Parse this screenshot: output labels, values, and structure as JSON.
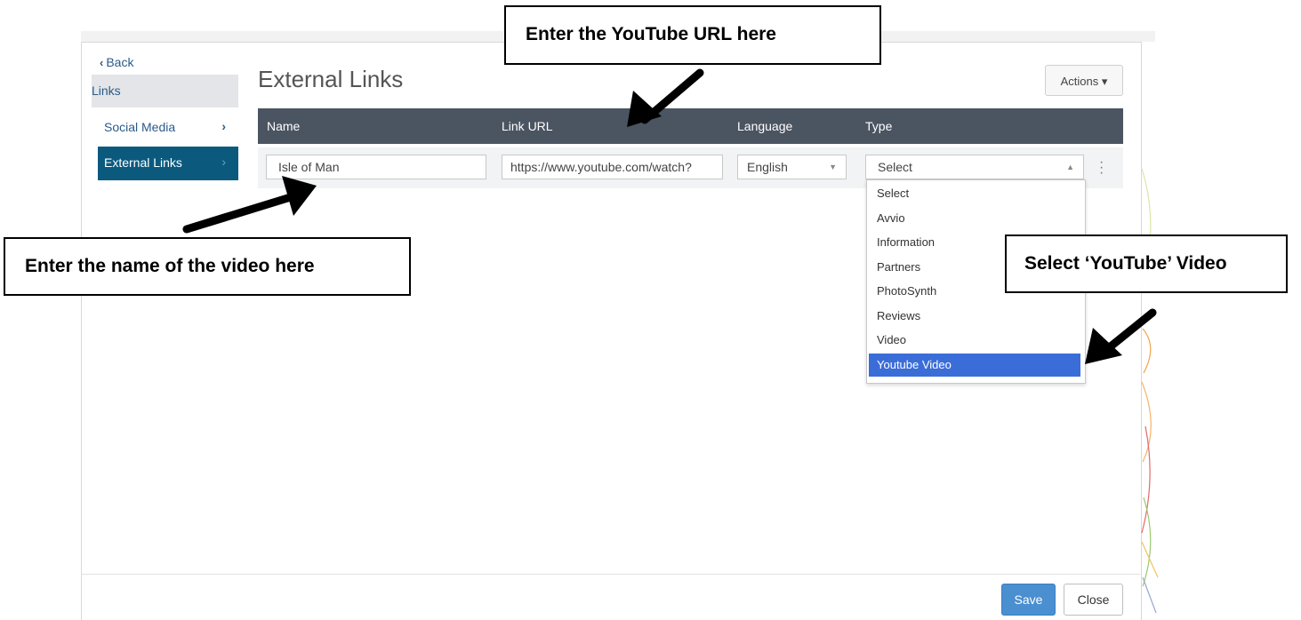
{
  "sidebar": {
    "back_label": "Back",
    "section_label": "Links",
    "items": [
      {
        "label": "Social Media"
      },
      {
        "label": "External Links"
      }
    ]
  },
  "main": {
    "title": "External Links",
    "actions_label": "Actions ▾",
    "columns": [
      "Name",
      "Link URL",
      "Language",
      "Type"
    ],
    "row": {
      "name": "Isle of Man",
      "url": "https://www.youtube.com/watch?",
      "language": "English",
      "type": "Select"
    },
    "type_options": [
      "Select",
      "Avvio",
      "Information",
      "Partners",
      "PhotoSynth",
      "Reviews",
      "Video",
      "Youtube Video"
    ],
    "selected_option": "Youtube Video"
  },
  "footer": {
    "save_label": "Save",
    "close_label": "Close"
  },
  "annotations": {
    "url_callout": "Enter the YouTube URL here",
    "name_callout": "Enter the name of the video here",
    "type_callout": "Select ‘YouTube’ Video"
  },
  "colors": {
    "nav_active_bg": "#0b5a7e",
    "table_header_bg": "#4b5461",
    "selected_option_bg": "#3b6dd8",
    "save_button_bg": "#4a8fd0"
  }
}
